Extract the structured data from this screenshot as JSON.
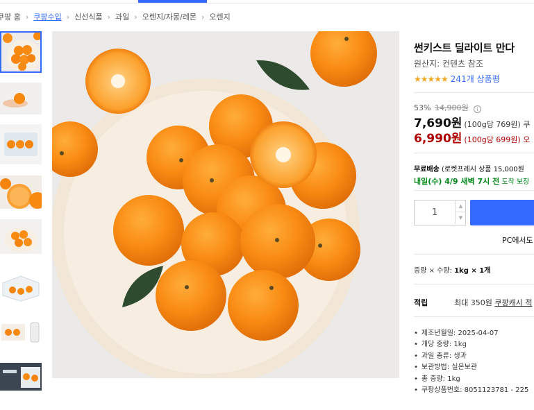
{
  "breadcrumb": [
    "쿠팡 홈",
    "쿠팡수입",
    "신선식품",
    "과일",
    "오렌지/자몽/레몬",
    "오렌지"
  ],
  "product": {
    "title": "썬키스트 딜라이트 만다",
    "origin": "원산지: 컨텐츠 참조",
    "stars": "★★★★★",
    "rating_value": 4.5,
    "review_count": "241개 상품평"
  },
  "price": {
    "discount_rate": "53%",
    "original_price": "14,900원",
    "info_icon": "info-icon",
    "sale_price": "7,690원",
    "sale_unit": "(100g당 769원) 쿠",
    "coupon_price": "6,990원",
    "coupon_unit": "(100g당 699원) 오"
  },
  "shipping": {
    "line1_bold": "무료배송",
    "line1_rest": " (로켓프레시 상품 15,000원",
    "eta_bold": "내일(수) 4/9 새벽 7시 전",
    "eta_rest": " 도착 보장"
  },
  "quantity": {
    "value": "1",
    "up_icon": "caret-up-icon",
    "down_icon": "caret-down-icon"
  },
  "pc_label": "PC에서도",
  "option": {
    "label": "중량 × 수량: ",
    "value": "1kg × 1개"
  },
  "cash": {
    "label": "적립",
    "text": "최대 350원 ",
    "link": "쿠팡캐시 적"
  },
  "details": [
    "제조년월일: 2025-04-07",
    "개당 중량: 1kg",
    "과일 종류: 생과",
    "보관방법: 실온보관",
    "총 중량: 1kg",
    "쿠팡상품번호: 8051123781 - 225"
  ],
  "colors": {
    "accent": "#346aff",
    "coupon": "#ae0000",
    "delivery": "#00891a",
    "star": "#f5a623"
  }
}
